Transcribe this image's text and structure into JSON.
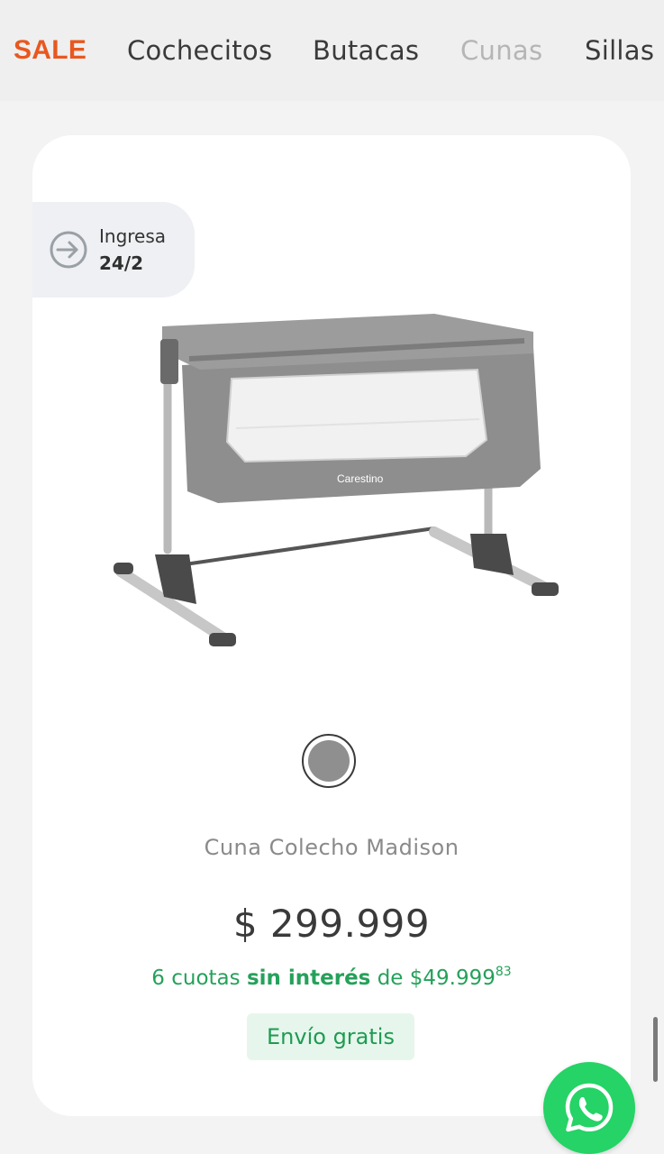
{
  "nav": {
    "items": [
      {
        "label": "SALE"
      },
      {
        "label": "Cochecitos"
      },
      {
        "label": "Butacas"
      },
      {
        "label": "Cunas"
      },
      {
        "label": "Sillas"
      }
    ]
  },
  "product": {
    "arrival_label": "Ingresa",
    "arrival_date": "24/2",
    "brand_print": "Carestino",
    "name": "Cuna Colecho Madison",
    "price": "$ 299.999",
    "installments": {
      "prefix": "6 cuotas ",
      "highlight": "sin interés",
      "middle": " de $49.999",
      "cents": "83"
    },
    "shipping": "Envío gratis",
    "swatch_color": "#8f8f8f"
  },
  "colors": {
    "sale": "#e8581e",
    "green": "#25a15a",
    "whatsapp": "#25d366"
  },
  "icons": {
    "arrival": "arrow-right-circle-icon",
    "whatsapp": "whatsapp-icon"
  }
}
